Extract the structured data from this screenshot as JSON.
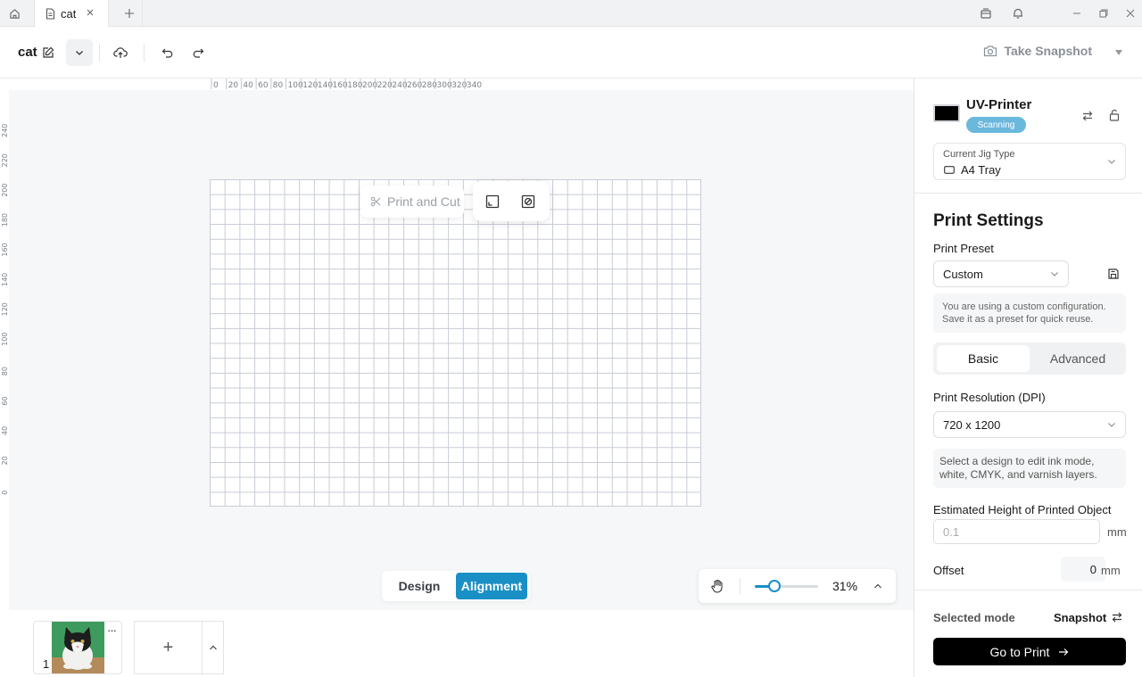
{
  "tabbar": {
    "tab_title": "cat",
    "home_icon": "home-icon",
    "close_icon": "close-icon",
    "new_tab_icon": "plus-icon"
  },
  "toolbar": {
    "doc_name": "cat",
    "snapshot_label": "Take Snapshot"
  },
  "rulers": {
    "top": [
      "0",
      "20",
      "40",
      "60",
      "80",
      "100",
      "120",
      "140",
      "160",
      "180",
      "200",
      "220",
      "240",
      "260",
      "280",
      "300",
      "320",
      "340"
    ],
    "left": [
      "240",
      "220",
      "200",
      "180",
      "160",
      "140",
      "120",
      "100",
      "80",
      "60",
      "40",
      "20",
      "0"
    ]
  },
  "canvas": {
    "print_and_cut_label": "Print and Cut",
    "mode_design": "Design",
    "mode_alignment": "Alignment",
    "zoom_percent": "31%",
    "zoom_level": 0.31,
    "grid_rows": 22,
    "grid_cols": 33
  },
  "pages": {
    "items": [
      {
        "number": "1",
        "more": "···"
      }
    ],
    "add_label": "+"
  },
  "panel": {
    "printer_name": "UV-Printer",
    "printer_status": "Scanning",
    "jig_label": "Current Jig Type",
    "jig_value": "A4 Tray",
    "print_settings_title": "Print Settings",
    "print_preset_label": "Print Preset",
    "print_preset_value": "Custom",
    "preset_note": "You are using a custom configuration. Save it as a preset for quick reuse.",
    "tab_basic": "Basic",
    "tab_advanced": "Advanced",
    "resolution_label": "Print Resolution (DPI)",
    "resolution_value": "720 x 1200",
    "design_note": "Select a design to edit ink mode, white, CMYK, and varnish layers.",
    "height_label": "Estimated Height of Printed Object",
    "height_placeholder": "0.1",
    "height_unit": "mm",
    "offset_label": "Offset",
    "offset_value": "0",
    "offset_unit": "mm",
    "selected_mode_label": "Selected mode",
    "selected_mode_value": "Snapshot",
    "go_to_print": "Go to Print"
  }
}
